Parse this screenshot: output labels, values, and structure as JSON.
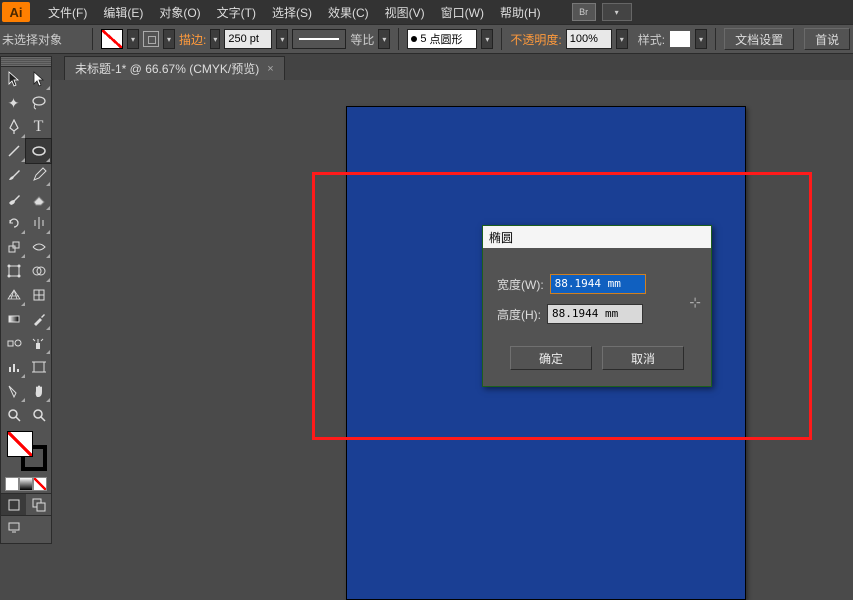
{
  "app": {
    "logo": "Ai"
  },
  "menu": {
    "items": [
      "文件(F)",
      "编辑(E)",
      "对象(O)",
      "文字(T)",
      "选择(S)",
      "效果(C)",
      "视图(V)",
      "窗口(W)",
      "帮助(H)"
    ],
    "br_label": "Br"
  },
  "options": {
    "no_selection": "未选择对象",
    "stroke_label": "描边:",
    "stroke_value": "250 pt",
    "equal": "等比",
    "brush_size": "5",
    "brush_name": "点圆形",
    "opacity_label": "不透明度:",
    "opacity_value": "100%",
    "style_label": "样式:",
    "doc_setup": "文档设置",
    "prefs": "首说"
  },
  "doc_tab": {
    "title": "未标题-1* @ 66.67% (CMYK/预览)",
    "close": "×"
  },
  "dialog": {
    "title": "椭圆",
    "width_label": "宽度(W):",
    "width_value": "88.1944 mm",
    "height_label": "高度(H):",
    "height_value": "88.1944 mm",
    "ok": "确定",
    "cancel": "取消"
  }
}
